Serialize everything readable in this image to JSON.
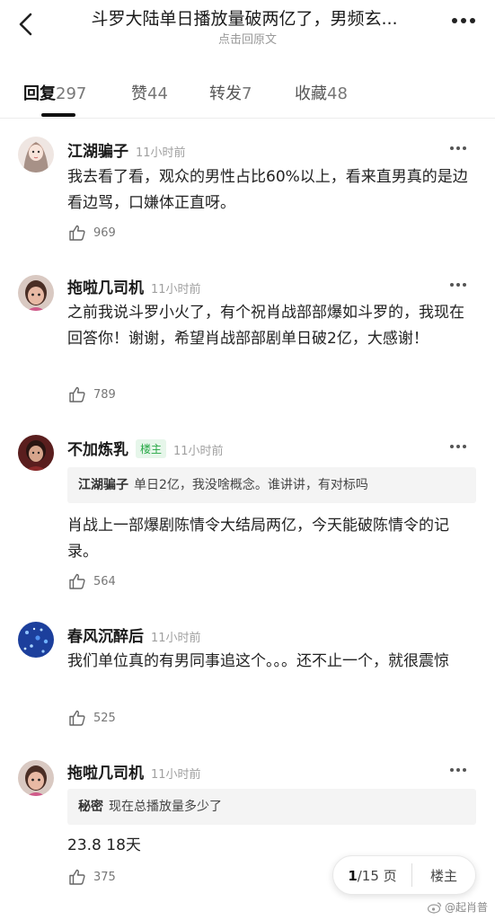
{
  "header": {
    "title": "斗罗大陆单日播放量破两亿了，男频玄...",
    "subtitle": "点击回原文"
  },
  "tabs": [
    {
      "label": "回复",
      "count": "297"
    },
    {
      "label": "赞",
      "count": "44"
    },
    {
      "label": "转发",
      "count": "7"
    },
    {
      "label": "收藏",
      "count": "48"
    }
  ],
  "comments": [
    {
      "name": "江湖骗子",
      "time": "11小时前",
      "text": "我去看了看，观众的男性占比60%以上，看来直男真的是边看边骂，口嫌体正直呀。",
      "likes": "969"
    },
    {
      "name": "拖啦几司机",
      "time": "11小时前",
      "text": "之前我说斗罗小火了，有个祝肖战部部爆如斗罗的，我现在回答你！谢谢，希望肖战部部剧单日破2亿，大感谢！",
      "likes": "789"
    },
    {
      "name": "不加炼乳",
      "badge": "楼主",
      "time": "11小时前",
      "quote_author": "江湖骗子",
      "quote_text": "单日2亿，我没啥概念。谁讲讲，有对标吗",
      "text": "肖战上一部爆剧陈情令大结局两亿，今天能破陈情令的记录。",
      "likes": "564"
    },
    {
      "name": "春风沉醉后",
      "time": "11小时前",
      "text": "我们单位真的有男同事追这个。。。还不止一个，就很震惊",
      "likes": "525"
    },
    {
      "name": "拖啦几司机",
      "time": "11小时前",
      "quote_author": "秘密",
      "quote_text": "现在总播放量多少了",
      "text": "23.8 18天",
      "likes": "375"
    }
  ],
  "pager": {
    "current": "1",
    "total_label": "/15 页",
    "louzhu_label": "楼主"
  },
  "watermark": "@起肖普"
}
